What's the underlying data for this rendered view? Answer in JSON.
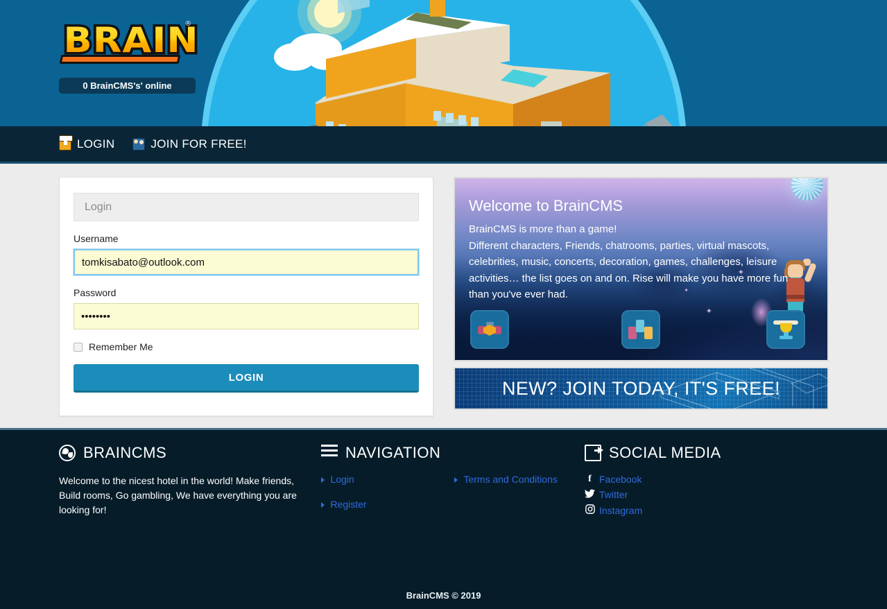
{
  "header": {
    "logo_text": "BRAIN",
    "logo_registered": "®",
    "online_counter": "0 BrainCMS's' online",
    "hero_alt": "isometric hotel building"
  },
  "nav": {
    "items": [
      {
        "label": "LOGIN",
        "icon": "chest-icon"
      },
      {
        "label": "JOIN FOR FREE!",
        "icon": "people-icon"
      }
    ]
  },
  "login_form": {
    "panel_title": "Login",
    "username_label": "Username",
    "username_value": "tomkisabato@outlook.com",
    "username_placeholder": "Username",
    "password_label": "Password",
    "password_value": "••••••••",
    "password_placeholder": "Password",
    "remember_label": "Remember Me",
    "remember_checked": false,
    "submit_label": "LOGIN"
  },
  "welcome": {
    "title": "Welcome to BrainCMS",
    "line1": "BrainCMS is more than a game!",
    "line2": "Different characters, Friends, chatrooms, parties, virtual mascots, celebrities, music, concerts, decoration, games, challenges, leisure activities… the list goes on and on. Rise will make you have more fun than you've ever had.",
    "badges": [
      {
        "name": "gem-icon"
      },
      {
        "name": "furniture-icon"
      },
      {
        "name": "trophy-icon"
      }
    ]
  },
  "join_banner": {
    "text": "NEW? JOIN TODAY, IT'S FREE!"
  },
  "footer": {
    "about": {
      "heading": "BRAINCMS",
      "icon": "globe-icon",
      "text": "Welcome to the nicest hotel in the world! Make friends, Build rooms, Go gambling, We have everything you are looking for!"
    },
    "navigation": {
      "heading": "NAVIGATION",
      "icon": "hamburger-icon",
      "column1": [
        {
          "label": "Login"
        },
        {
          "label": "Register"
        }
      ],
      "column2": [
        {
          "label": "Terms and Conditions"
        }
      ]
    },
    "social": {
      "heading": "SOCIAL MEDIA",
      "icon": "share-icon",
      "links": [
        {
          "label": "Facebook",
          "icon": "facebook-icon",
          "glyph": "f"
        },
        {
          "label": "Twitter",
          "icon": "twitter-icon",
          "glyph": "🐦"
        },
        {
          "label": "Instagram",
          "icon": "instagram-icon",
          "glyph": "◎"
        }
      ]
    },
    "copyright": "BrainCMS © 2019"
  },
  "colors": {
    "header_blue": "#0b6394",
    "sky_blue": "#28b3e8",
    "nav_dark": "#0a2636",
    "footer_dark": "#061c29",
    "button_blue": "#1c8cba",
    "link_blue": "#2f6bdb",
    "input_yellow": "#fbfbd4"
  }
}
